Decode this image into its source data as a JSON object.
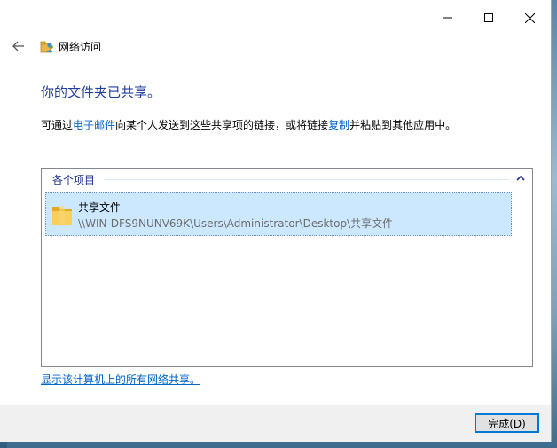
{
  "window": {
    "app_title": "网络访问",
    "icons": {
      "minimize": "minimize-icon",
      "maximize": "maximize-icon",
      "close": "close-icon",
      "back": "back-arrow-icon",
      "app": "network-access-icon"
    }
  },
  "main": {
    "heading": "你的文件夹已共享。",
    "desc_prefix": "可通过",
    "desc_link_email": "电子邮件",
    "desc_middle": "向某个人发送到这些共享项的链接，或将链接",
    "desc_link_copy": "复制",
    "desc_suffix": "并粘贴到其他应用中。"
  },
  "list": {
    "group_label": "各个项目",
    "items": [
      {
        "name": "共享文件",
        "path": "\\\\WIN-DFS9NUNV69K\\Users\\Administrator\\Desktop\\共享文件",
        "icon": "folder-icon"
      }
    ]
  },
  "footer": {
    "show_all_link": "显示该计算机上的所有网络共享。",
    "done_button": "完成(D)"
  },
  "colors": {
    "heading": "#1f3e9c",
    "link": "#0063c7",
    "selection": "#cce8ff",
    "accent": "#0078d7"
  }
}
